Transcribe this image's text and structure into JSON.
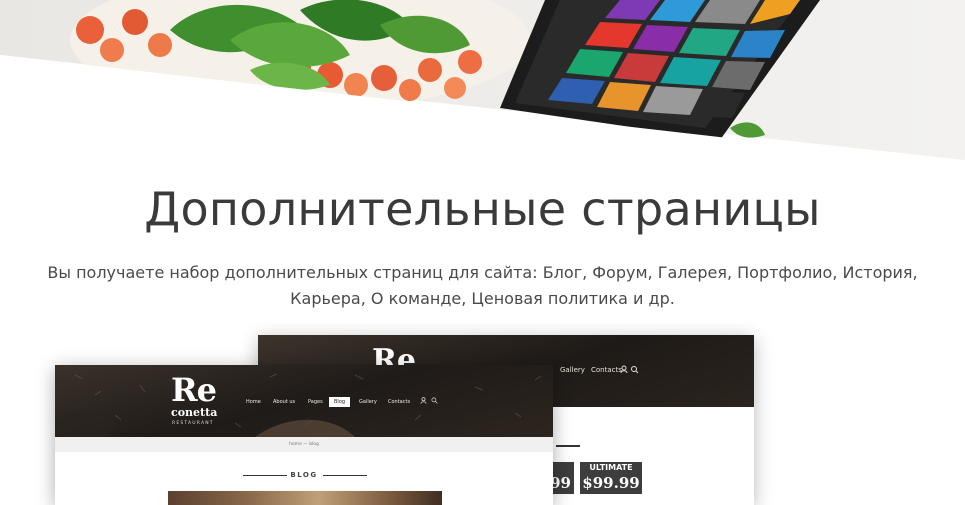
{
  "section": {
    "title": "Дополнительные страницы",
    "description": "Вы получаете набор дополнительных страниц для сайта: Блог, Форум, Галерея, Портфолио, История, Карьера, О команде, Ценовая политика и др."
  },
  "mockup_front": {
    "logo_main": "Re",
    "logo_sub": "conetta",
    "logo_tag": "RESTAURANT",
    "nav": [
      "Home",
      "About us",
      "Pages",
      "Blog",
      "Gallery",
      "Contacts"
    ],
    "active_nav": "Blog",
    "breadcrumb": "home — blog",
    "blog_heading": "BLOG"
  },
  "mockup_back": {
    "logo_main": "Re",
    "nav": [
      "Gallery",
      "Contacts"
    ],
    "plan_left_price": "$99",
    "plan_right_label": "ULTIMATE",
    "plan_right_price": "$99.99"
  },
  "colors": {
    "heading": "#3a3a3a",
    "header_dark": "#1f1b18",
    "price_bg": "#3d3d3d"
  }
}
